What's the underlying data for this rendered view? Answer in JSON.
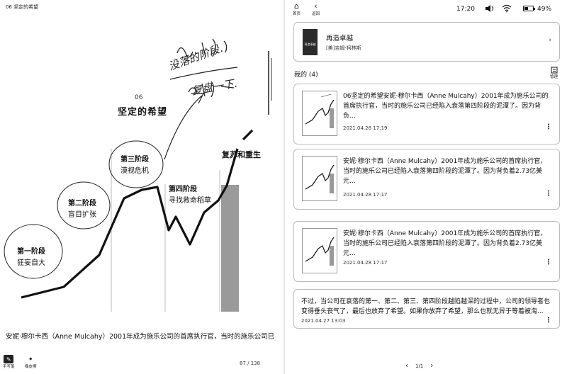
{
  "left_page": {
    "top_title": "06 坚定的希望",
    "chapter_num": "06",
    "chapter_title": "坚定的希望",
    "stages": [
      {
        "title": "第一阶段",
        "subtitle": "狂妄自大"
      },
      {
        "title": "第二阶段",
        "subtitle": "盲目扩张"
      },
      {
        "title": "第三阶段",
        "subtitle": "漠视危机"
      },
      {
        "title": "第四阶段",
        "subtitle": "寻找救命稻草"
      },
      {
        "title": "复苏和重生",
        "subtitle": ""
      }
    ],
    "handwriting": {
      "line1": "没落的阶段.",
      "line2": "复盘一下."
    },
    "body_text": "安妮·穆尔卡西（Anne Mulcahy）2001年成为施乐公司的首席执行官，当时的施乐公司已",
    "page_number": "87 / 138",
    "tools": [
      {
        "icon": "pen-icon",
        "label": "手写笔"
      },
      {
        "icon": "eraser-icon",
        "label": "橡皮擦"
      }
    ],
    "curve_icon": "growth-curve-diagram"
  },
  "right_panel": {
    "nav": {
      "home_label": "首页",
      "back_label": "返回"
    },
    "status": {
      "time": "17:20",
      "battery": "49%",
      "battery_level": 0.49
    },
    "book": {
      "title": "再造卓越",
      "author": "[美]吉姆·柯林斯",
      "cover_text": "再造卓越"
    },
    "section_title": "我的 (4)",
    "manage_label": "管理",
    "notes": [
      {
        "text": "06坚定的希望安妮·穆尔卡西（Anne Mulcahy）2001年成为施乐公司的首席执行官，当时的施乐公司已经陷入衰落第四阶段的泥潭了。因为背负...",
        "date": "2021.04.28 17:19",
        "has_thumb": true
      },
      {
        "text": "安妮·穆尔卡西（Anne Mulcahy）2001年成为施乐公司的首席执行官，当时的施乐公司已经陷入衰落第四阶段的泥潭了。因为背负着2.73亿美元...",
        "date": "2021.04.28 17:17",
        "has_thumb": true
      },
      {
        "text": "安妮·穆尔卡西（Anne Mulcahy）2001年成为施乐公司的首席执行官，当时的施乐公司已经陷入衰落第四阶段的泥潭了。因为背负着2.73亿美元...",
        "date": "2021.04.28 17:17",
        "has_thumb": true
      },
      {
        "text": "不过，当公司在衰落的第一、第二、第三、第四阶段越陷越深的过程中，公司的领导者也变得垂头丧气了，最后也放弃了希望。如果你放弃了希望，那么也就无异于等着被淘...",
        "date": "2021.04.27 13:03",
        "has_thumb": false
      }
    ],
    "pager": {
      "label": "1/1"
    },
    "icons": {
      "home": "home-icon",
      "back": "back-icon",
      "volume": "volume-icon",
      "wifi": "wifi-icon",
      "battery": "battery-icon",
      "manage": "manage-icon",
      "more": "more-vertical-icon",
      "prev": "chevron-left-icon",
      "next": "chevron-right-icon"
    }
  }
}
